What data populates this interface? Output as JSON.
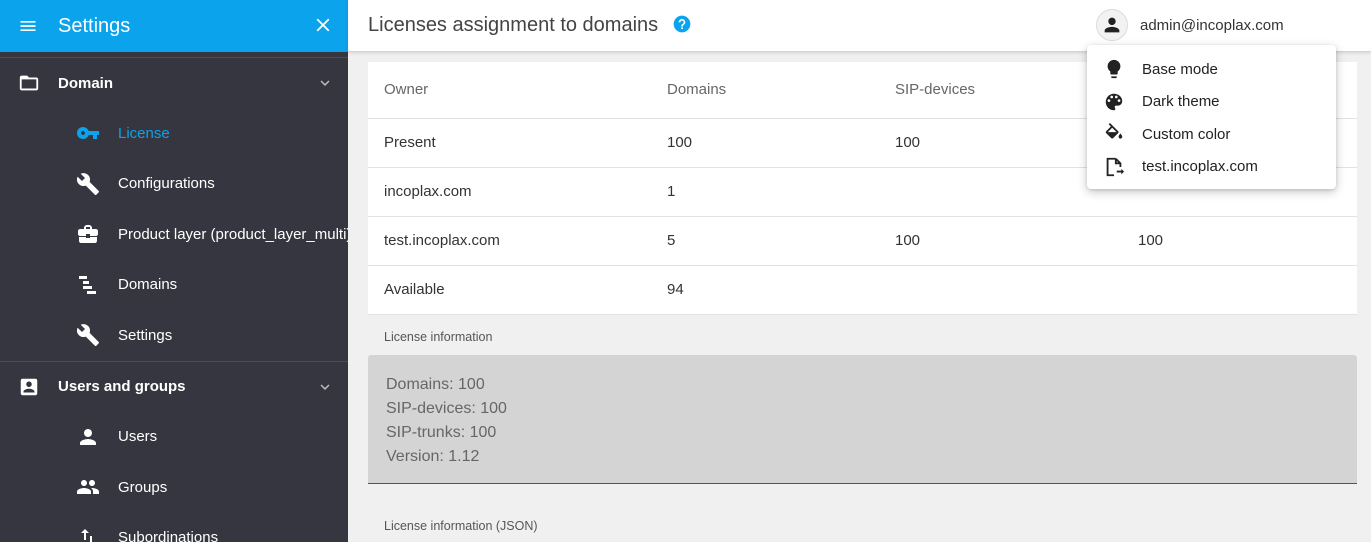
{
  "sidebar": {
    "title": "Settings",
    "sections": [
      {
        "label": "Domain",
        "items": [
          {
            "label": "License",
            "icon": "key-icon",
            "active": true
          },
          {
            "label": "Configurations",
            "icon": "wrench-icon"
          },
          {
            "label": "Product layer (product_layer_multi)",
            "icon": "briefcase-icon"
          },
          {
            "label": "Domains",
            "icon": "tree-icon"
          },
          {
            "label": "Settings",
            "icon": "wrench-icon"
          }
        ]
      },
      {
        "label": "Users and groups",
        "items": [
          {
            "label": "Users",
            "icon": "person-icon"
          },
          {
            "label": "Groups",
            "icon": "group-icon"
          },
          {
            "label": "Subordinations",
            "icon": "sort-arrows-icon"
          }
        ]
      }
    ]
  },
  "header": {
    "title": "Licenses assignment to domains",
    "user": "admin@incoplax.com"
  },
  "table": {
    "columns": [
      "Owner",
      "Domains",
      "SIP-devices",
      ""
    ],
    "rows": [
      [
        "Present",
        "100",
        "100",
        ""
      ],
      [
        "incoplax.com",
        "1",
        "",
        ""
      ],
      [
        "test.incoplax.com",
        "5",
        "100",
        "100"
      ],
      [
        "Available",
        "94",
        "",
        ""
      ]
    ]
  },
  "license_info": {
    "label": "License information",
    "lines": [
      "Domains: 100",
      "SIP-devices: 100",
      "SIP-trunks: 100",
      "Version: 1.12"
    ]
  },
  "license_json": {
    "label": "License information (JSON)"
  },
  "menu": {
    "items": [
      {
        "label": "Base mode",
        "icon": "lightbulb-icon"
      },
      {
        "label": "Dark theme",
        "icon": "palette-icon"
      },
      {
        "label": "Custom color",
        "icon": "paint-bucket-icon"
      },
      {
        "label": "test.incoplax.com",
        "icon": "domain-export-icon"
      }
    ]
  },
  "colors": {
    "accent": "#0aa3ec",
    "sidebar_bg": "#363640"
  }
}
